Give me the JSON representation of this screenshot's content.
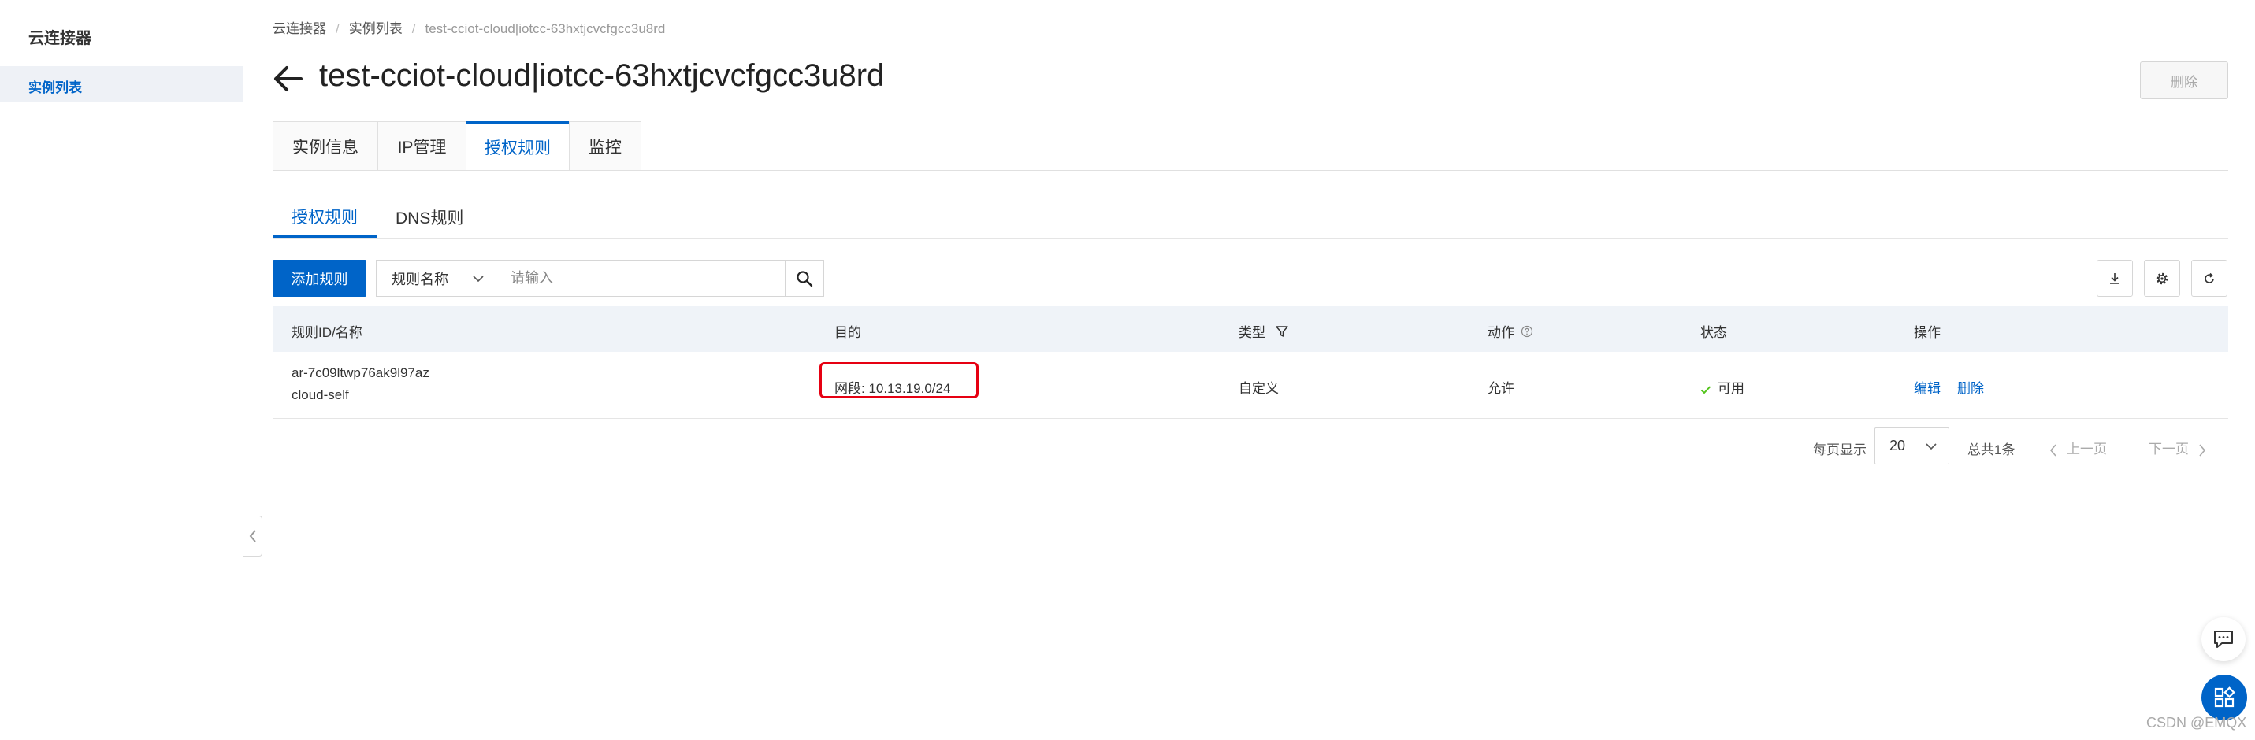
{
  "sidebar": {
    "title": "云连接器",
    "items": [
      {
        "label": "实例列表",
        "active": true
      }
    ]
  },
  "breadcrumb": [
    "云连接器",
    "实例列表",
    "test-cciot-cloud|iotcc-63hxtjcvcfgcc3u8rd"
  ],
  "header": {
    "title": "test-cciot-cloud|iotcc-63hxtjcvcfgcc3u8rd",
    "delete_label": "删除"
  },
  "tabs": [
    {
      "label": "实例信息",
      "active": false
    },
    {
      "label": "IP管理",
      "active": false
    },
    {
      "label": "授权规则",
      "active": true
    },
    {
      "label": "监控",
      "active": false
    }
  ],
  "subtabs": [
    {
      "label": "授权规则",
      "active": true
    },
    {
      "label": "DNS规则",
      "active": false
    }
  ],
  "toolbar": {
    "add_label": "添加规则",
    "filter_selected": "规则名称",
    "search_placeholder": "请输入"
  },
  "table": {
    "headers": [
      "规则ID/名称",
      "目的",
      "类型",
      "动作",
      "状态",
      "操作"
    ],
    "rows": [
      {
        "id": "ar-7c09ltwp76ak9l97az",
        "name": "cloud-self",
        "destination": "网段: 10.13.19.0/24",
        "type": "自定义",
        "action": "允许",
        "status": "可用",
        "op_edit": "编辑",
        "op_delete": "删除"
      }
    ]
  },
  "pagination": {
    "per_page_label": "每页显示",
    "page_size": "20",
    "total": "总共1条",
    "prev": "上一页",
    "next": "下一页"
  },
  "watermark": "CSDN @EMQX",
  "colors": {
    "primary": "#0064c8",
    "highlight": "#e60012",
    "success": "#52c41a"
  }
}
